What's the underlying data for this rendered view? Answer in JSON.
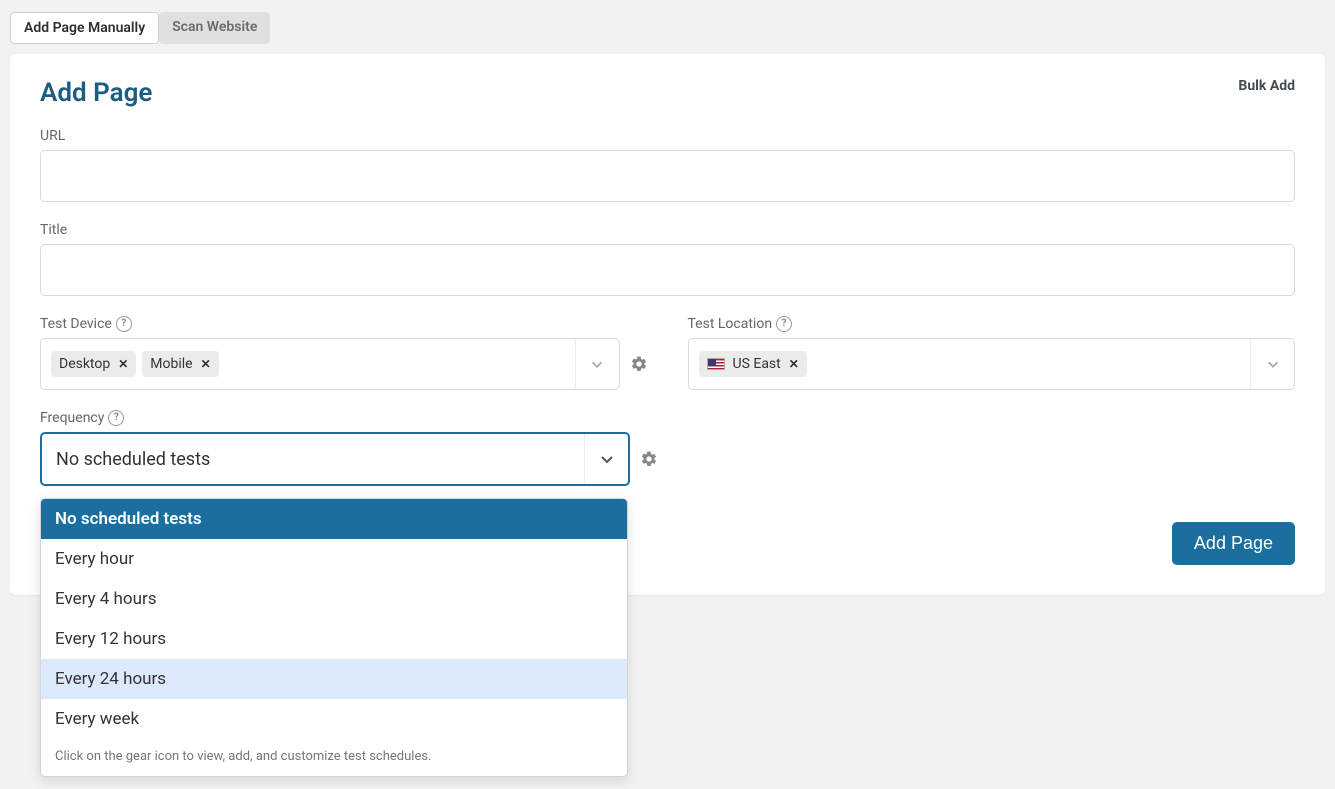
{
  "tabs": {
    "add_manual": "Add Page Manually",
    "scan": "Scan Website"
  },
  "header": {
    "title": "Add Page",
    "bulk_add": "Bulk Add"
  },
  "fields": {
    "url_label": "URL",
    "url_value": "",
    "title_label": "Title",
    "title_value": "",
    "device_label": "Test Device",
    "location_label": "Test Location",
    "frequency_label": "Frequency"
  },
  "device_chips": [
    {
      "label": "Desktop"
    },
    {
      "label": "Mobile"
    }
  ],
  "location_chips": [
    {
      "label": "US East",
      "flag": "us"
    }
  ],
  "frequency": {
    "selected": "No scheduled tests",
    "options": [
      "No scheduled tests",
      "Every hour",
      "Every 4 hours",
      "Every 12 hours",
      "Every 24 hours",
      "Every week"
    ],
    "hovered_index": 4,
    "footer_hint": "Click on the gear icon to view, add, and customize test schedules."
  },
  "buttons": {
    "submit": "Add Page"
  },
  "icons": {
    "help": "?",
    "remove": "✕"
  }
}
